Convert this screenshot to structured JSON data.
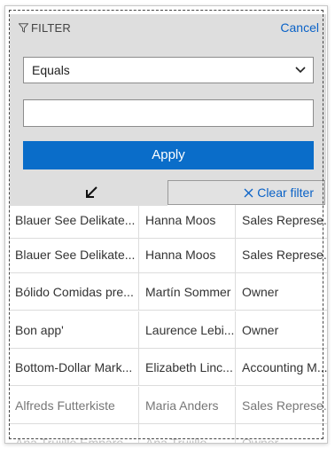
{
  "filter_panel": {
    "title": "FILTER",
    "cancel_label": "Cancel",
    "operator_selected": "Equals",
    "value_input": "",
    "apply_label": "Apply",
    "clear_filter_label": "Clear filter"
  },
  "grid": {
    "rows": [
      {
        "company": "Blauer See Delikate...",
        "contact": "Hanna Moos",
        "title": "Sales Represe..."
      },
      {
        "company": "Blauer See Delikate...",
        "contact": "Hanna Moos",
        "title": "Sales Represe..."
      },
      {
        "company": "Bólido Comidas pre...",
        "contact": "Martín Sommer",
        "title": "Owner"
      },
      {
        "company": "Bon app'",
        "contact": "Laurence Lebi...",
        "title": "Owner"
      },
      {
        "company": "Bottom-Dollar Mark...",
        "contact": "Elizabeth Linc...",
        "title": "Accounting M..."
      },
      {
        "company": "Alfreds Futterkiste",
        "contact": "Maria Anders",
        "title": "Sales Represe..."
      },
      {
        "company": "Ana Trujillo Empare...",
        "contact": "Ana Trujillo",
        "title": "Owner"
      }
    ]
  },
  "colors": {
    "accent": "#0a6dc9",
    "link": "#0a62c7",
    "panel_bg": "#dedede"
  },
  "icons": [
    "filter-icon",
    "chevron-down-icon",
    "resize-arrow-icon",
    "close-icon"
  ]
}
